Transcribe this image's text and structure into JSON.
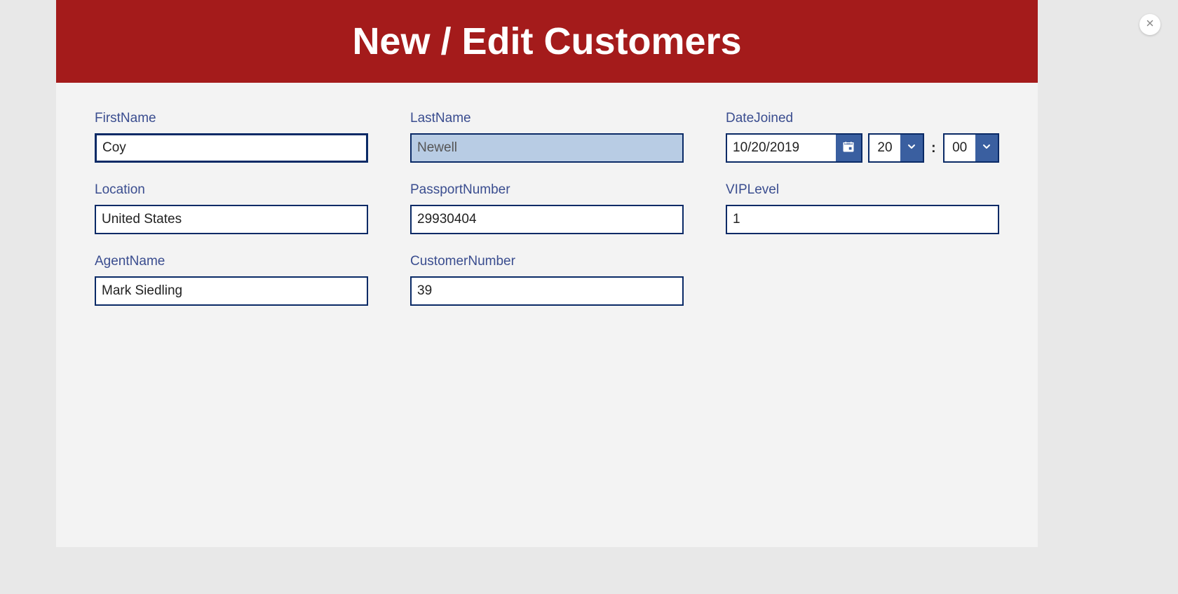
{
  "modal": {
    "title": "New / Edit Customers"
  },
  "fields": {
    "firstName": {
      "label": "FirstName",
      "value": "Coy"
    },
    "lastName": {
      "label": "LastName",
      "value": "Newell"
    },
    "dateJoined": {
      "label": "DateJoined",
      "date": "10/20/2019",
      "hour": "20",
      "minute": "00"
    },
    "location": {
      "label": "Location",
      "value": "United States"
    },
    "passportNumber": {
      "label": "PassportNumber",
      "value": "29930404"
    },
    "vipLevel": {
      "label": "VIPLevel",
      "value": "1"
    },
    "agentName": {
      "label": "AgentName",
      "value": "Mark Siedling"
    },
    "customerNumber": {
      "label": "CustomerNumber",
      "value": "39"
    }
  },
  "timeSeparator": ":"
}
